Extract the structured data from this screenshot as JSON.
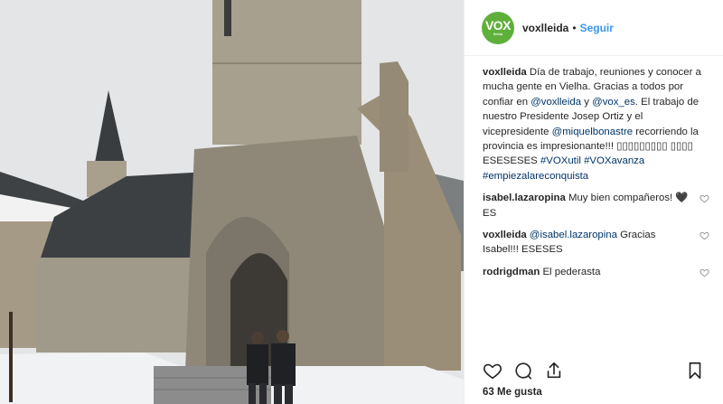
{
  "header": {
    "avatar_logo": "VOX",
    "avatar_sub": "lleida",
    "username": "voxlleida",
    "separator": "•",
    "follow_label": "Seguir"
  },
  "caption": {
    "username": "voxlleida",
    "p1": " Día de trabajo, reuniones y conocer a mucha gente en Vielha. Gracias a todos por confiar en ",
    "m1": "@voxlleida",
    "p2": " y ",
    "m2": "@vox_es",
    "p3": ". El trabajo de nuestro Presidente Josep Ortiz y el vicepresidente ",
    "m3": "@miquelbonastre",
    "p4": " recorriendo la provincia es impresionante!!! ▯▯▯▯▯▯▯▯▯ ▯▯▯▯ ESESESES ",
    "h1": "#VOXutil",
    "p5": " ",
    "h2": "#VOXavanza",
    "p6": " ",
    "h3": "#empiezalareconquista"
  },
  "comments": [
    {
      "username": "isabel.lazaropina",
      "text": " Muy bien compañeros! 🖤ES"
    },
    {
      "username": "voxlleida",
      "mention": "@isabel.lazaropina",
      "text": " Gracias Isabel!!! ESESES"
    },
    {
      "username": "rodrigdman",
      "text": " El pederasta"
    }
  ],
  "likes": "63 Me gusta",
  "colors": {
    "brand_green": "#5fb03a",
    "link_blue": "#003569",
    "follow_blue": "#3897f0"
  },
  "icons": [
    "heart-icon",
    "comment-icon",
    "share-icon",
    "bookmark-icon",
    "heart-small-icon"
  ]
}
